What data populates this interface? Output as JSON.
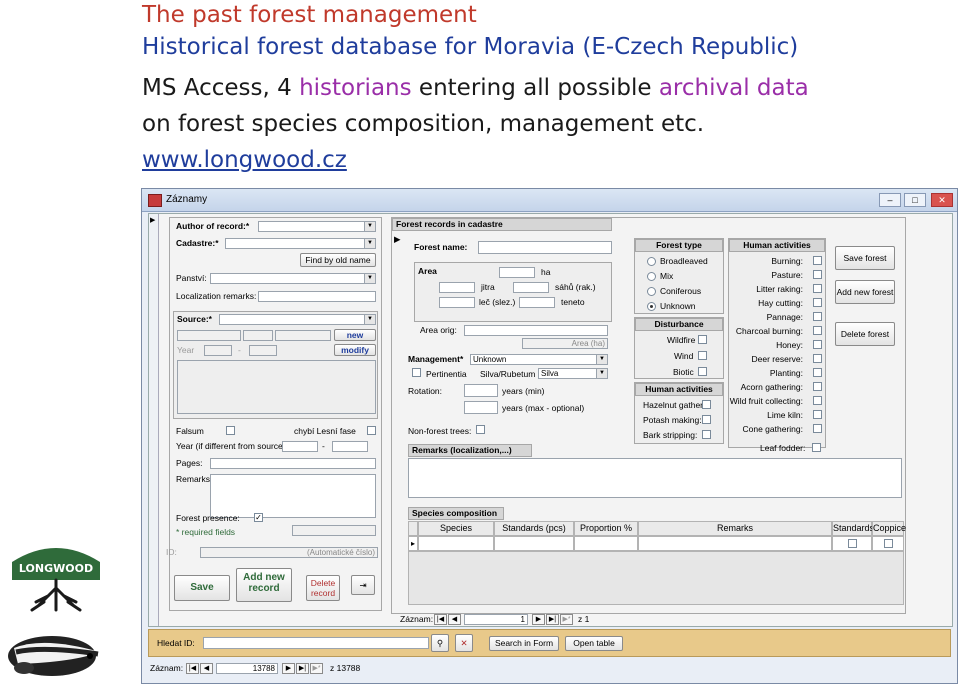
{
  "slide": {
    "title": "The past forest management",
    "line2": "Historical forest database for Moravia (E-Czech Republic)",
    "line3_a": "MS Access, 4 ",
    "line3_b": "historians",
    "line3_c": " entering all possible ",
    "line3_d": "archival data",
    "line4": "on forest species composition, management etc.",
    "link": "www.longwood.cz",
    "logo_text": "LONGWOOD"
  },
  "window": {
    "title": "Záznamy",
    "minimize": "–",
    "maximize": "□",
    "close": "✕"
  },
  "left": {
    "author_label": "Author of record:*",
    "cadastre_label": "Cadastre:*",
    "find_button": "Find by old name",
    "panstvi_label": "Panství:",
    "localization_label": "Localization remarks:",
    "source_label": "Source:*",
    "new_button": "new",
    "modify_button": "modify",
    "year_label": "Year",
    "dash": "-",
    "falsum_label": "Falsum",
    "chybi_label": "chybí Lesní fase",
    "year_diff_label": "Year (if different from source):",
    "pages_label": "Pages:",
    "remarks_label": "Remarks:",
    "forest_presence_label": "Forest presence:",
    "required_label": "* required fields",
    "id_label": "ID:",
    "auto_label": "(Automatické číslo)",
    "save_button": "Save",
    "add_button": "Add new record",
    "delete_button": "Delete record"
  },
  "records": {
    "header": "Forest records in cadastre",
    "forest_name_label": "Forest name:",
    "area_label": "Area",
    "ha": "ha",
    "jitra": "jitra",
    "sahu": "sáhů (rak.)",
    "lec": "leč (slez.)",
    "teneto": "teneto",
    "area_orig_label": "Area orig:",
    "area_ha_label": "Area (ha)",
    "management_label": "Management*",
    "management_value": "Unknown",
    "pertinentia_label": "Pertinentia",
    "silva_label": "Silva/Rubetum",
    "silva_value": "Silva",
    "rotation_label": "Rotation:",
    "years_min": "years (min)",
    "years_max": "years (max - optional)",
    "nonforest_label": "Non-forest trees:",
    "remarks_header": "Remarks (localization,...)",
    "forest_type_header": "Forest type",
    "forest_types": [
      "Broadleaved",
      "Mix",
      "Coniferous",
      "Unknown"
    ],
    "disturbance_header": "Disturbance",
    "disturbances": [
      "Wildfire",
      "Wind",
      "Biotic"
    ],
    "human_left_header": "Human activities",
    "human_left": [
      "Hazelnut gather.:",
      "Potash making:",
      "Bark stripping:"
    ],
    "human_right_header": "Human activities",
    "human_right": [
      "Burning:",
      "Pasture:",
      "Litter raking:",
      "Hay cutting:",
      "Pannage:",
      "Charcoal burning:",
      "Honey:",
      "Deer reserve:",
      "Planting:",
      "Acorn gathering:",
      "Wild fruit collecting:",
      "Lime kiln:",
      "Cone gathering:",
      "Leaf fodder:"
    ],
    "save_forest": "Save forest",
    "add_forest": "Add new forest",
    "delete_forest": "Delete forest"
  },
  "species": {
    "header": "Species composition",
    "columns": [
      "Species",
      "Standards (pcs)",
      "Proportion %",
      "Remarks",
      "Standards",
      "Coppice"
    ],
    "nav_label": "Záznam:",
    "nav_value": "1",
    "nav_of": "z 1"
  },
  "bottom": {
    "hledat_label": "Hledat ID:",
    "search_button": "Search in Form",
    "open_button": "Open table",
    "nav_label": "Záznam:",
    "nav_value": "13788",
    "nav_of": "z 13788"
  }
}
